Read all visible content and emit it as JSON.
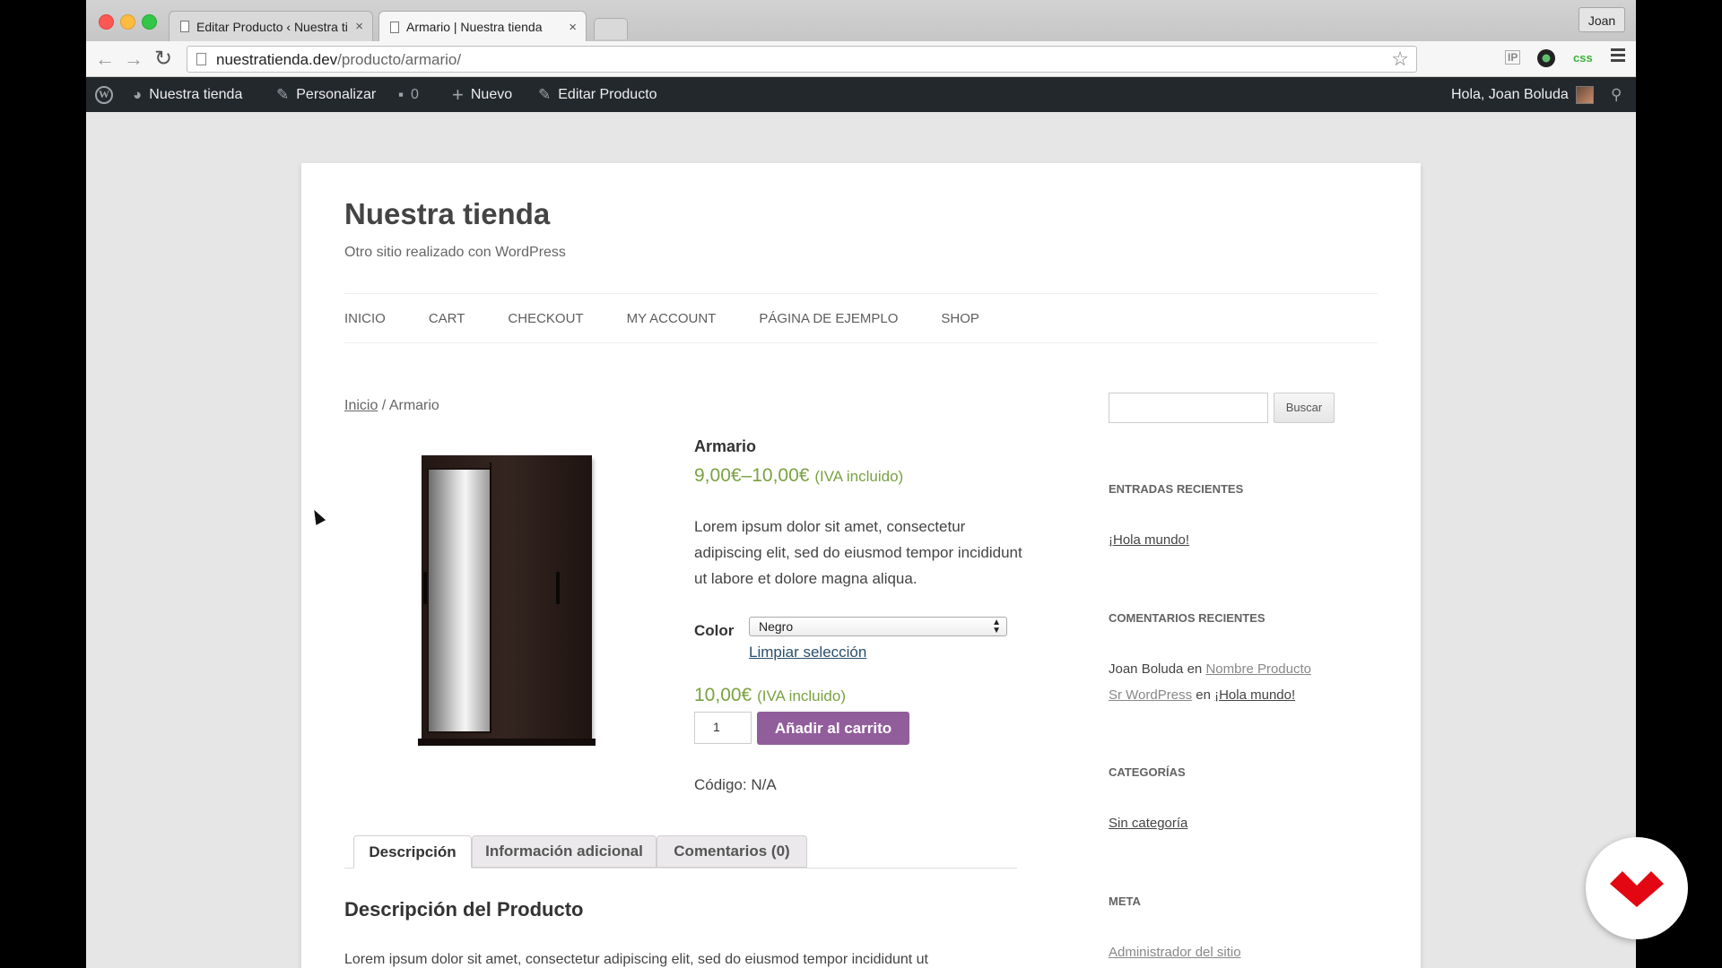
{
  "browser": {
    "tabs": [
      {
        "title": "Editar Producto ‹ Nuestra tie",
        "active": false
      },
      {
        "title": "Armario | Nuestra tienda",
        "active": true
      }
    ],
    "close_glyph": "×",
    "user_label": "Joan",
    "url_host": "nuestratienda.dev",
    "url_path": "/producto/armario/",
    "ext_ip": "IP",
    "ext_css": "css",
    "back_glyph": "←",
    "forward_glyph": "→",
    "reload_glyph": "↻",
    "star_glyph": "☆"
  },
  "adminbar": {
    "site_name": "Nuestra tienda",
    "customize": "Personalizar",
    "comments_count": "0",
    "new_label": "Nuevo",
    "edit_product": "Editar Producto",
    "greeting": "Hola, Joan Boluda",
    "icons": {
      "wp": "W",
      "dashboard": "◕",
      "brush": "✎",
      "comment": "▪",
      "plus": "+",
      "pencil": "✎",
      "search": "⚲"
    }
  },
  "site": {
    "title": "Nuestra tienda",
    "description": "Otro sitio realizado con WordPress",
    "nav": [
      "INICIO",
      "CART",
      "CHECKOUT",
      "MY ACCOUNT",
      "PÁGINA DE EJEMPLO",
      "SHOP"
    ]
  },
  "breadcrumb": {
    "home": "Inicio",
    "separator": " / ",
    "current": "Armario"
  },
  "product": {
    "name": "Armario",
    "price_range": "9,00€–10,00€",
    "price_suffix": "(IVA incluido)",
    "short_description": "Lorem ipsum dolor sit amet, consectetur adipiscing elit, sed do eiusmod tempor incididunt ut labore et dolore magna aliqua.",
    "color_label": "Color",
    "color_selected": "Negro",
    "reset_label": "Limpiar selección",
    "variation_price": "10,00€",
    "variation_suffix": "(IVA incluido)",
    "quantity": "1",
    "add_to_cart": "Añadir al carrito",
    "sku_label": "Código: N/A"
  },
  "tabs": [
    "Descripción",
    "Información adicional",
    "Comentarios (0)"
  ],
  "description": {
    "title": "Descripción del Producto",
    "text": "Lorem ipsum dolor sit amet, consectetur adipiscing elit, sed do eiusmod tempor incididunt ut"
  },
  "sidebar": {
    "search_button": "Buscar",
    "recent_posts_title": "ENTRADAS RECIENTES",
    "recent_post": "¡Hola mundo!",
    "recent_comments_title": "COMENTARIOS RECIENTES",
    "comment1_author": "Joan Boluda",
    "comment_in": "en",
    "comment1_link": "Nombre Producto",
    "comment2_author": "Sr WordPress",
    "comment2_link": "¡Hola mundo!",
    "categories_title": "CATEGORÍAS",
    "category": "Sin categoría",
    "meta_title": "META",
    "meta_link": "Administrador del sitio"
  },
  "colors": {
    "accent_purple": "#915e9b",
    "price_green": "#7aa242",
    "admin_bar": "#23282d",
    "badge_red": "#e30613"
  }
}
